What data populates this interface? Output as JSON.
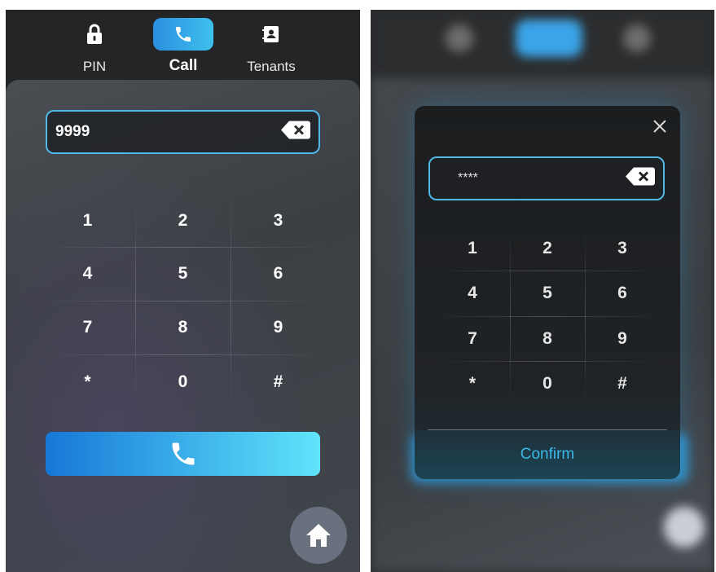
{
  "left_screen": {
    "nav": [
      {
        "label": "PIN",
        "icon": "lock-icon",
        "active": false
      },
      {
        "label": "Call",
        "icon": "phone-icon",
        "active": true
      },
      {
        "label": "Tenants",
        "icon": "contacts-icon",
        "active": false
      }
    ],
    "input": {
      "value": "9999"
    },
    "keypad": [
      "1",
      "2",
      "3",
      "4",
      "5",
      "6",
      "7",
      "8",
      "9",
      "*",
      "0",
      "#"
    ],
    "call_button_icon": "phone-icon",
    "home_button_icon": "home-icon"
  },
  "right_screen": {
    "dialog": {
      "input": {
        "value": "****"
      },
      "keypad": [
        "1",
        "2",
        "3",
        "4",
        "5",
        "6",
        "7",
        "8",
        "9",
        "*",
        "0",
        "#"
      ],
      "confirm_label": "Confirm",
      "close_icon": "close-icon"
    }
  },
  "colors": {
    "accent": "#4fb8e8",
    "call_gradient_start": "#1677d6",
    "call_gradient_end": "#5fe4fb",
    "confirm_text": "#3ab8e8"
  }
}
